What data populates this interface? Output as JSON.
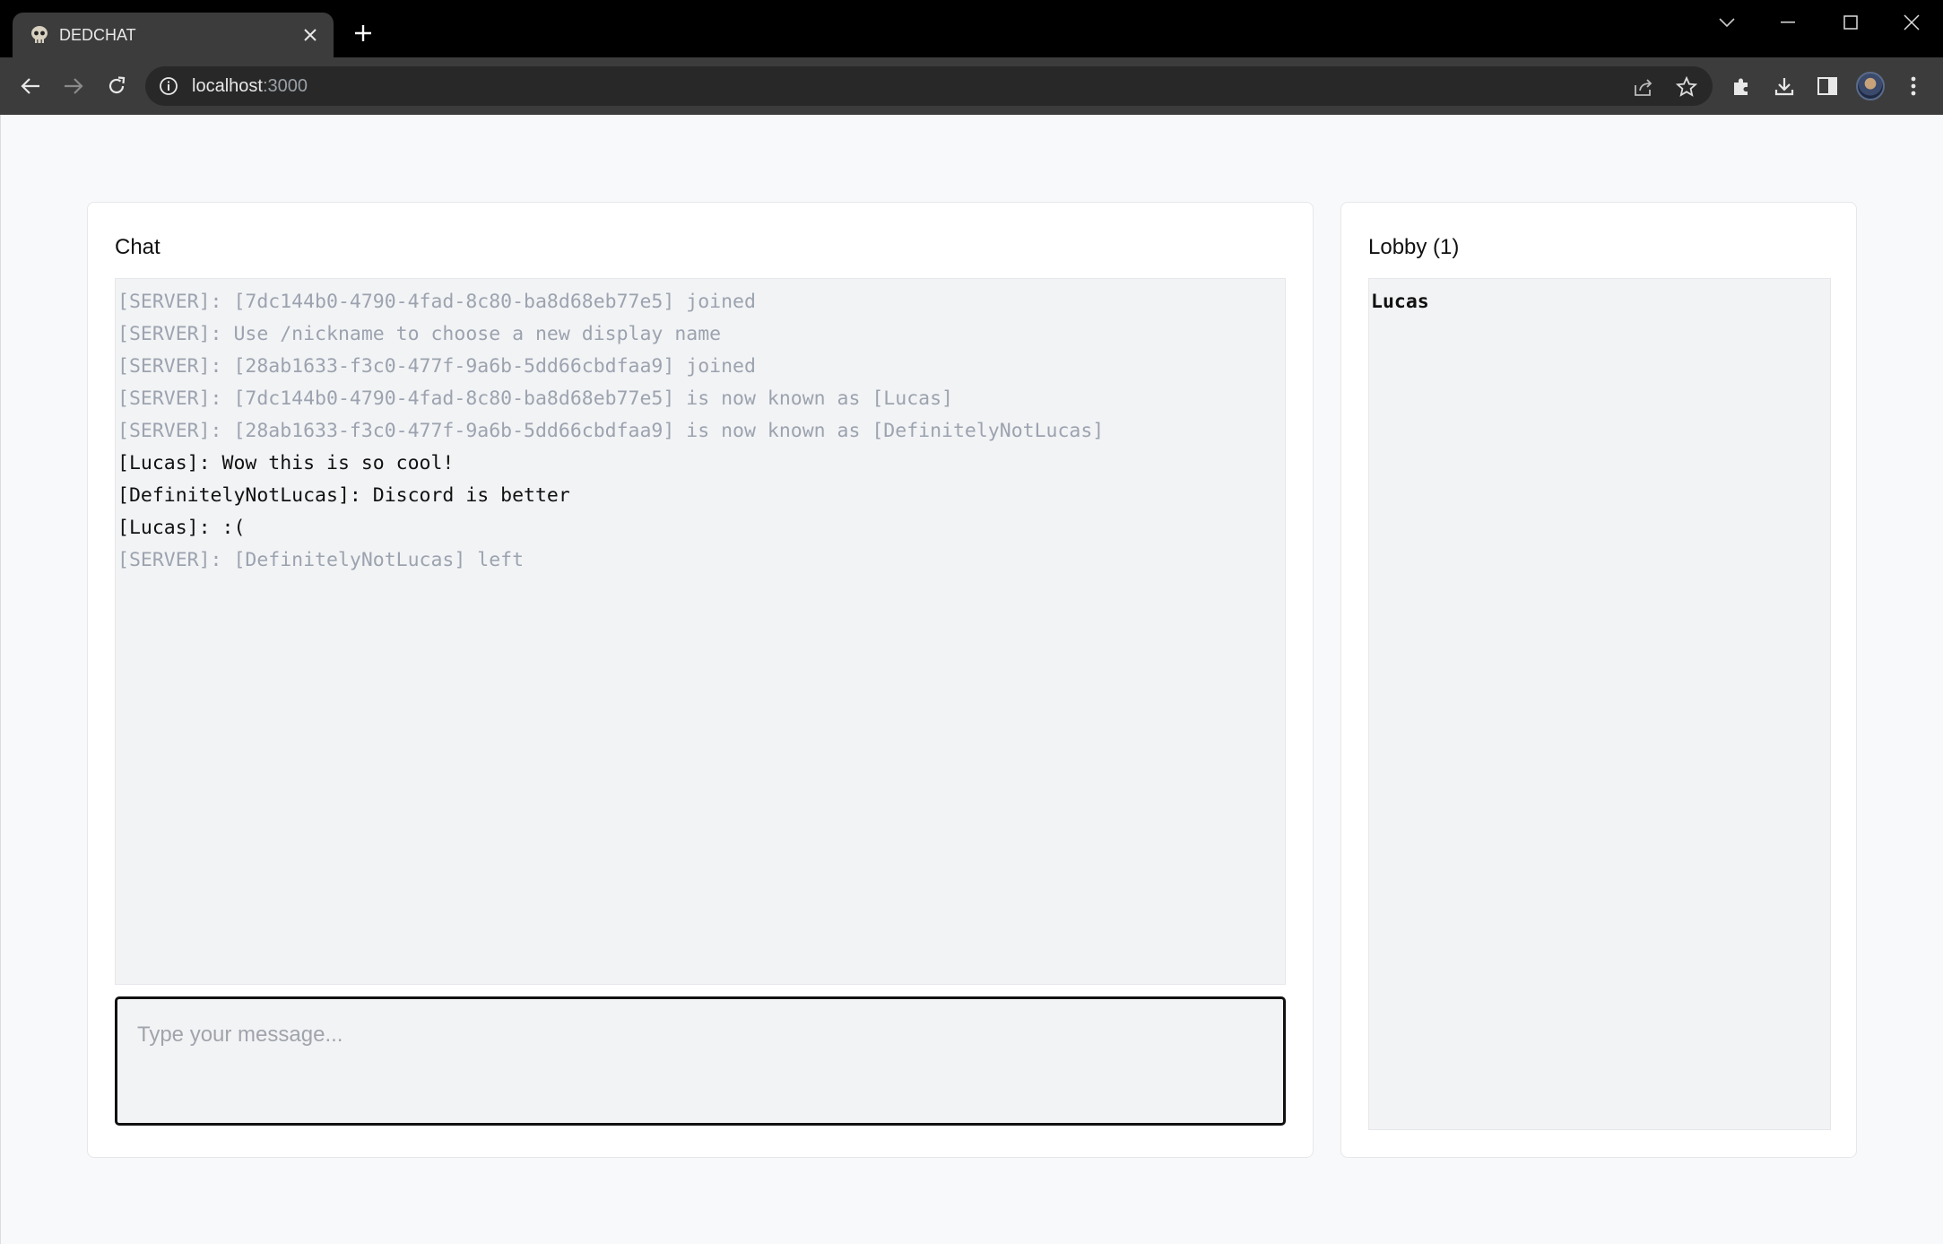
{
  "browser": {
    "tab_title": "DEDCHAT",
    "url_host": "localhost",
    "url_port": ":3000"
  },
  "chat": {
    "title": "Chat",
    "messages": [
      {
        "kind": "server",
        "text": "[SERVER]: [7dc144b0-4790-4fad-8c80-ba8d68eb77e5] joined"
      },
      {
        "kind": "server",
        "text": "[SERVER]: Use /nickname to choose a new display name"
      },
      {
        "kind": "server",
        "text": "[SERVER]: [28ab1633-f3c0-477f-9a6b-5dd66cbdfaa9] joined"
      },
      {
        "kind": "server",
        "text": "[SERVER]: [7dc144b0-4790-4fad-8c80-ba8d68eb77e5] is now known as [Lucas]"
      },
      {
        "kind": "server",
        "text": "[SERVER]: [28ab1633-f3c0-477f-9a6b-5dd66cbdfaa9] is now known as [DefinitelyNotLucas]"
      },
      {
        "kind": "user",
        "text": "[Lucas]: Wow this is so cool!"
      },
      {
        "kind": "user",
        "text": "[DefinitelyNotLucas]: Discord is better"
      },
      {
        "kind": "user",
        "text": "[Lucas]: :("
      },
      {
        "kind": "server",
        "text": "[SERVER]: [DefinitelyNotLucas] left"
      }
    ],
    "input_placeholder": "Type your message...",
    "input_value": ""
  },
  "lobby": {
    "title": "Lobby (1)",
    "users": [
      "Lucas"
    ]
  },
  "colors": {
    "server_text": "#9ca3af",
    "user_text": "#111111",
    "panel_bg": "#f2f3f5",
    "page_bg": "#f8f9fa"
  }
}
